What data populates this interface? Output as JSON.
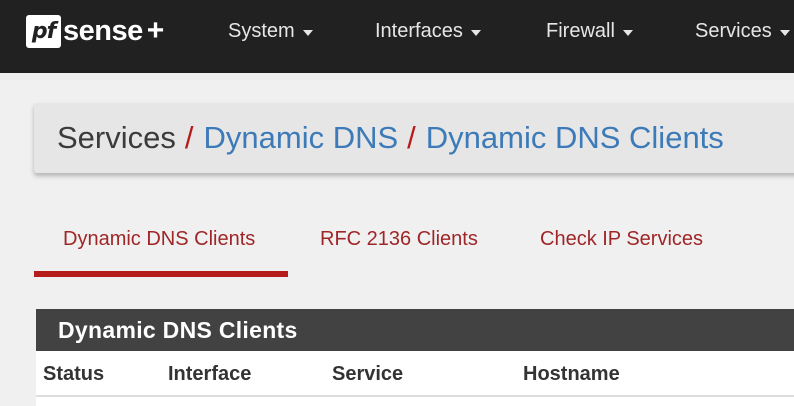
{
  "brand": {
    "logo_mark": "pf",
    "logo_text": "sense",
    "logo_plus": "+"
  },
  "nav": {
    "items": [
      {
        "label": "System"
      },
      {
        "label": "Interfaces"
      },
      {
        "label": "Firewall"
      },
      {
        "label": "Services"
      }
    ]
  },
  "breadcrumb": {
    "root": "Services",
    "separator": "/",
    "level1": "Dynamic DNS",
    "level2": "Dynamic DNS Clients"
  },
  "tabs": [
    {
      "label": "Dynamic DNS Clients",
      "active": true
    },
    {
      "label": "RFC 2136 Clients",
      "active": false
    },
    {
      "label": "Check IP Services",
      "active": false
    }
  ],
  "panel": {
    "title": "Dynamic DNS Clients",
    "columns": [
      "Status",
      "Interface",
      "Service",
      "Hostname"
    ]
  },
  "colors": {
    "navbar": "#212121",
    "accent_red": "#b71c1c",
    "link_blue": "#3d7ab8",
    "panel_heading": "#424242"
  }
}
